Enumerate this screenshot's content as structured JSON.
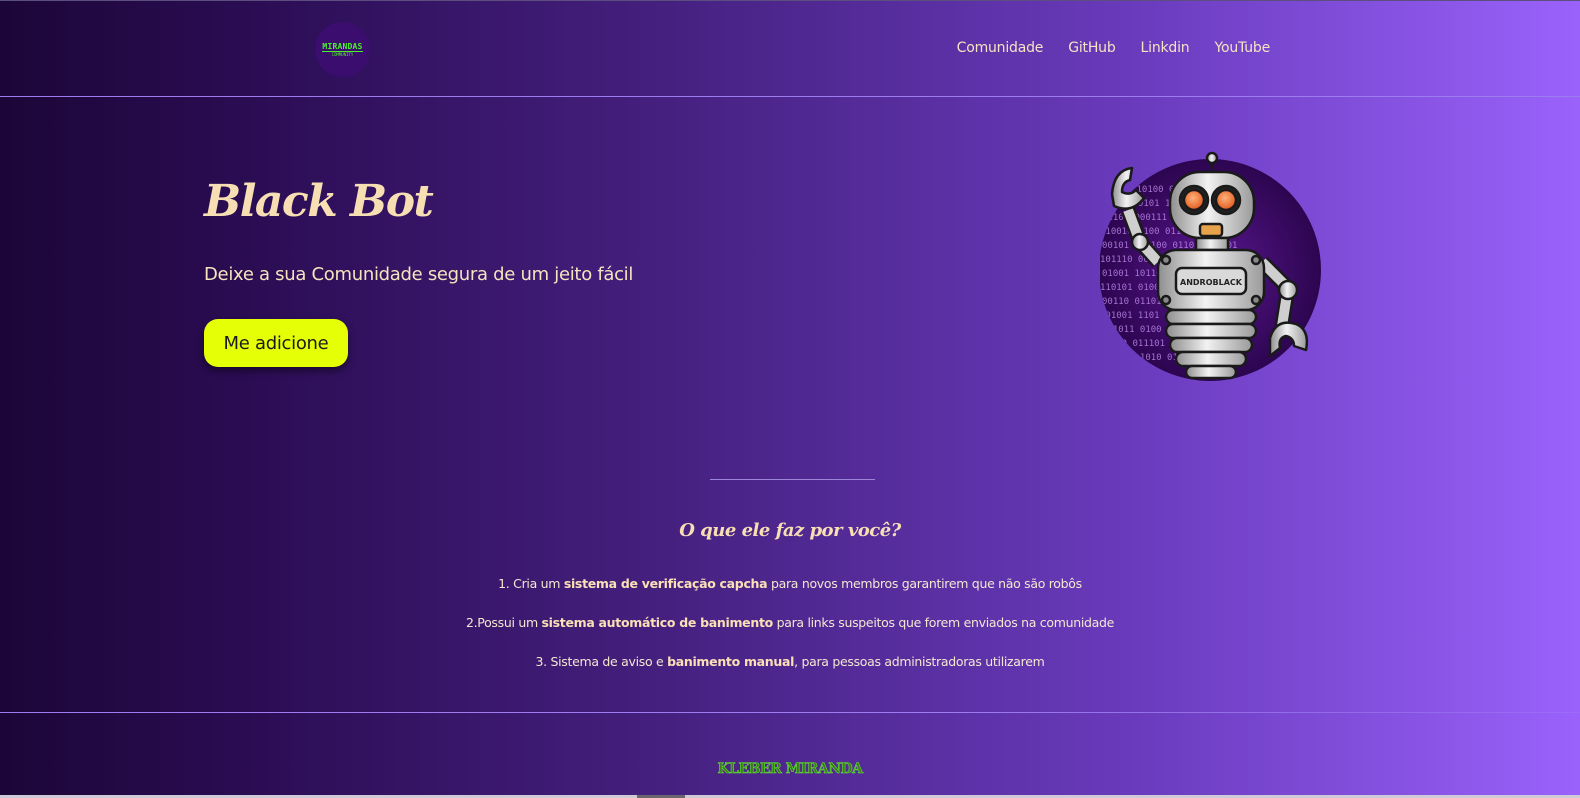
{
  "header": {
    "logo": {
      "title": "MIRANDAS",
      "subtitle": "COMMUNITY",
      "color": "#4cf22a"
    },
    "nav": [
      {
        "label": "Comunidade"
      },
      {
        "label": "GitHub"
      },
      {
        "label": "Linkdin"
      },
      {
        "label": "YouTube"
      }
    ]
  },
  "hero": {
    "title": "Black Bot",
    "subtitle": "Deixe a sua Comunidade segura de um jeito fácil",
    "cta_label": "Me adicione",
    "cta_color": "#e4ff06",
    "robot_badge": "ANDROBLACK"
  },
  "features": {
    "title": "O que ele faz por você?",
    "items": [
      {
        "pre": "1. Cria um ",
        "bold": "sistema de verificação capcha",
        "post": " para novos membros garantirem que não são robôs"
      },
      {
        "pre": "2.Possui um ",
        "bold": "sistema automático de banimento",
        "post": " para links suspeitos que forem enviados na comunidade"
      },
      {
        "pre": "3. Sistema de aviso e ",
        "bold": "banimento manual",
        "post": ", para pessoas administradoras utilizarem"
      }
    ]
  },
  "footer": {
    "name": "KLEBER MIRANDA"
  },
  "colors": {
    "background_start": "#1c0638",
    "background_end": "#9a62fb",
    "accent_text": "#f7dfb3"
  }
}
